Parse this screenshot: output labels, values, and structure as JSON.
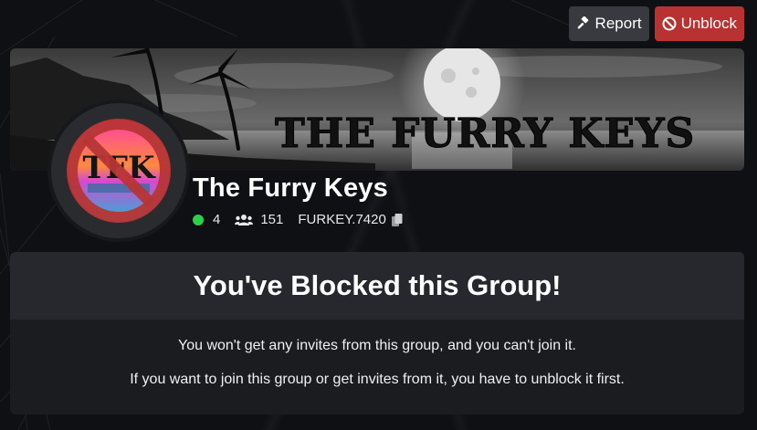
{
  "actions": {
    "report_label": "Report",
    "unblock_label": "Unblock"
  },
  "banner": {
    "title_text": "THE FURRY KEYS"
  },
  "avatar": {
    "initials": "TFK"
  },
  "group": {
    "name": "The Furry Keys",
    "online_count": "4",
    "member_count": "151",
    "code": "FURKEY.7420"
  },
  "blocked": {
    "heading": "You've Blocked this Group!",
    "message_1": "You won't get any invites from this group, and you can't join it.",
    "message_2": "If you want to join this group or get invites from it, you have to unblock it first."
  },
  "colors": {
    "background": "#0f1013",
    "report_button": "#383a3f",
    "unblock_button": "#b83232",
    "online_dot": "#2dd04a",
    "card_header": "#26282d",
    "card_body": "#1b1c20"
  },
  "icons": {
    "report": "gavel-icon",
    "unblock": "block-icon",
    "online": "online-dot-icon",
    "members": "users-icon",
    "copy": "copy-icon"
  }
}
